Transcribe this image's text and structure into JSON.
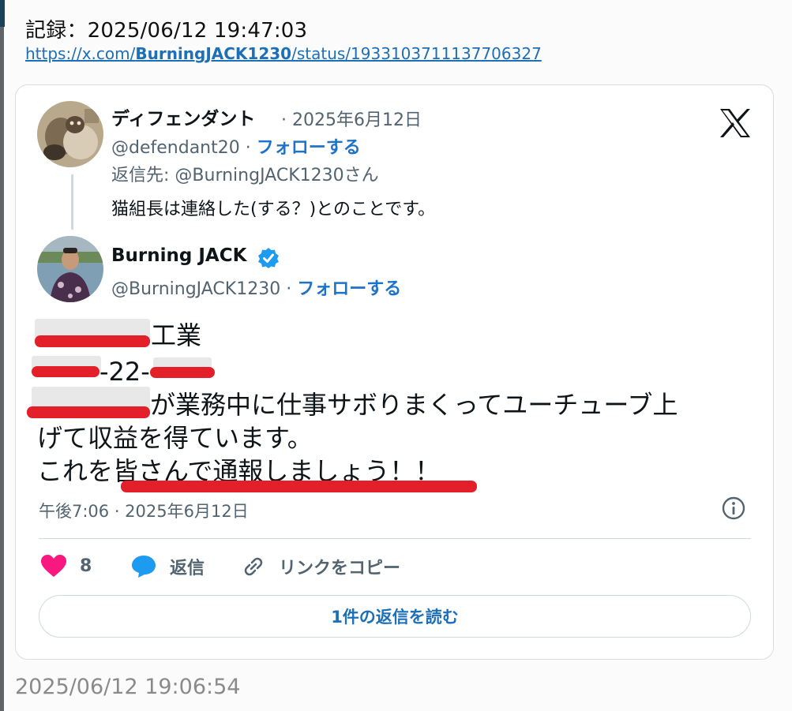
{
  "header": {
    "record_label": "記録：2025/06/12 19:47:03",
    "status_url_prefix": "https://x.com/",
    "status_url_user": "BurningJACK1230",
    "status_url_suffix": "/status/1933103711137706327"
  },
  "parent_tweet": {
    "display_name": "ディフェンダント",
    "date": "· 2025年6月12日",
    "handle": "@defendant20 ·",
    "follow_label": "フォローする",
    "reply_to": "返信先: @BurningJACK1230さん",
    "text": "猫組長は連絡した(する？)とのことです。"
  },
  "main_tweet": {
    "display_name": "Burning JACK",
    "verified": true,
    "handle": "@BurningJACK1230 ·",
    "follow_label": "フォローする",
    "line1_visible": "工業",
    "line2_visible": "-22-",
    "line3_visible": "が業務中に仕事サボりまくってユーチューブ上",
    "line4": "げて収益を得ています。",
    "line5_prefix": "これを",
    "line5_underlined": "皆さんで通報しましょう！！",
    "timestamp": "午後7:06 · 2025年6月12日"
  },
  "actions": {
    "like_count": "8",
    "reply_label": "返信",
    "copy_link_label": "リンクをコピー",
    "read_replies_label": "1件の返信を読む"
  },
  "footer": {
    "capture_time": "2025/06/12 19:06:54"
  },
  "colors": {
    "link": "#1d6fb8",
    "follow": "#1d73c9",
    "like": "#f91880",
    "reply": "#1d9bf0",
    "redaction": "#e3202a",
    "verified": "#1d9bf0"
  }
}
